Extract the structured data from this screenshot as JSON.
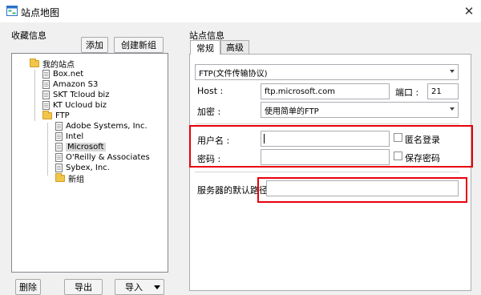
{
  "window": {
    "title": "站点地图",
    "close_glyph": "✕"
  },
  "left": {
    "section_label": "收藏信息",
    "add_button": "添加",
    "create_group_button": "创建新组",
    "delete_button": "删除",
    "export_button": "导出",
    "import_button": "导入"
  },
  "tree": {
    "root_label": "我的站点",
    "root_items": [
      "Box.net",
      "Amazon S3",
      "SKT Tcloud biz",
      "KT Ucloud biz"
    ],
    "ftp_label": "FTP",
    "ftp_items": [
      "Adobe Systems, Inc.",
      "Intel",
      "Microsoft",
      "O'Reilly & Associates",
      "Sybex, Inc."
    ],
    "new_group_label": "新组",
    "selected": "Microsoft"
  },
  "right": {
    "section_label": "站点信息",
    "tabs": [
      "常规",
      "高级"
    ],
    "protocol_value": "FTP(文件传输协议)",
    "host_label": "Host :",
    "host_value": "ftp.microsoft.com",
    "port_label": "端口 :",
    "port_value": "21",
    "encrypt_label": "加密 :",
    "encrypt_value": "使用简单的FTP",
    "username_label": "用户名 :",
    "username_value": "",
    "anonymous_label": "匿名登录",
    "password_label": "密码 :",
    "password_value": "",
    "save_password_label": "保存密码",
    "default_path_label": "服务器的默认路径",
    "default_path_value": ""
  },
  "colors": {
    "highlight_box": "#e8000b",
    "folder": "#f2c54b"
  }
}
